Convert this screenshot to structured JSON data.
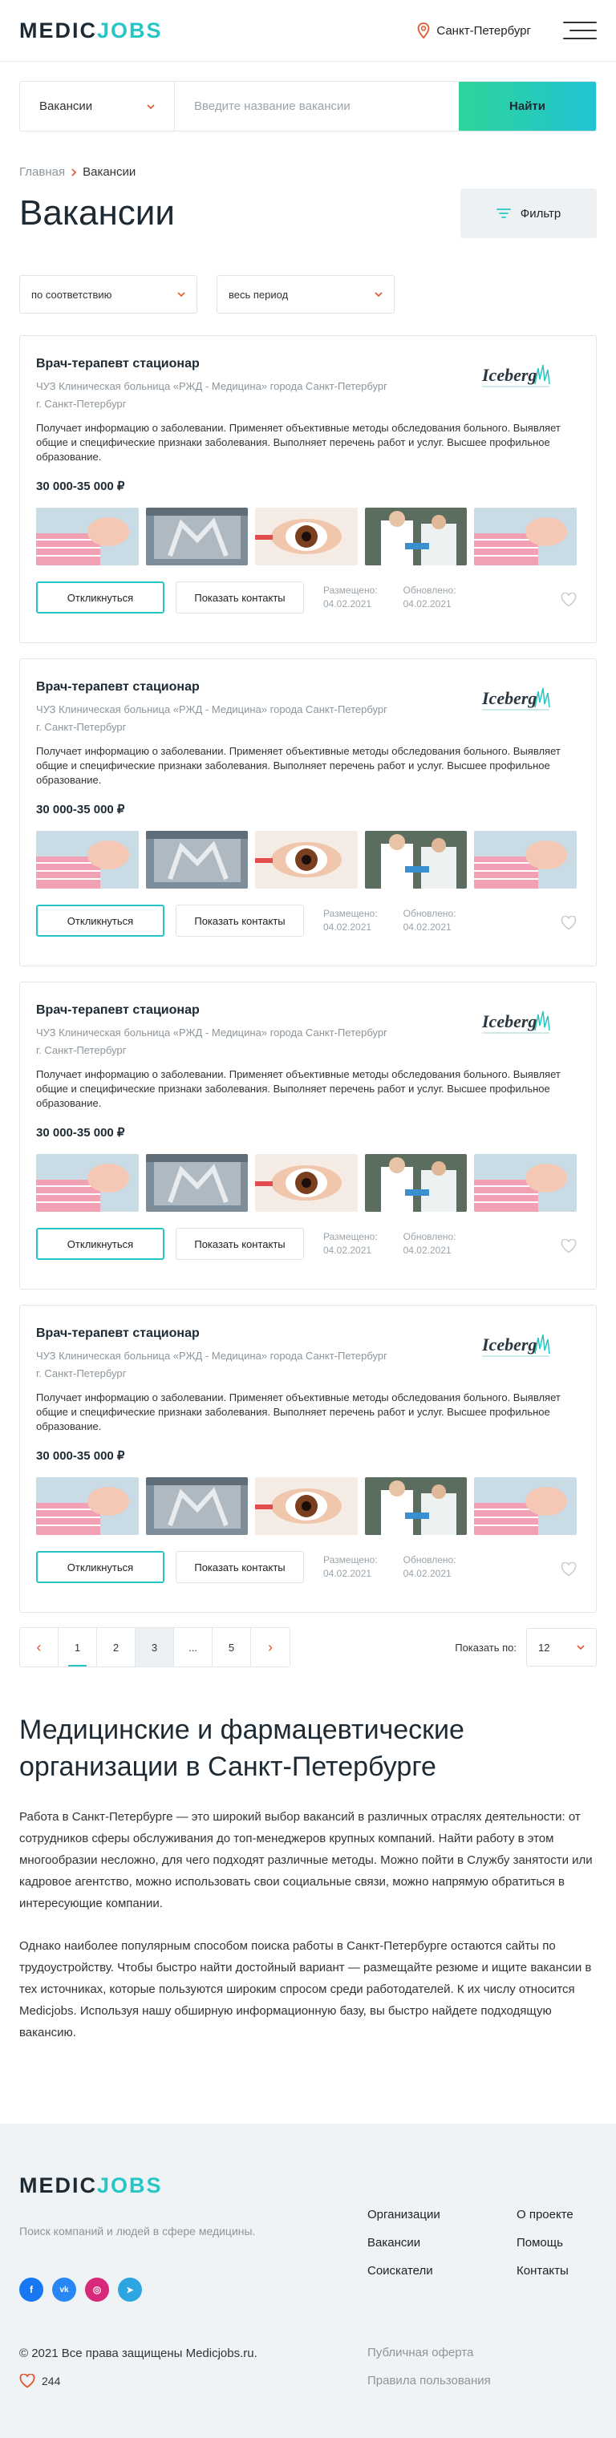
{
  "header": {
    "logo_part1": "MEDIC",
    "logo_part2": "JOBS",
    "city": "Санкт-Петербург"
  },
  "search": {
    "category": "Вакансии",
    "placeholder": "Введите название вакансии",
    "button": "Найти"
  },
  "breadcrumb": {
    "home": "Главная",
    "current": "Вакансии"
  },
  "page": {
    "title": "Вакансии",
    "filter": "Фильтр"
  },
  "sort": {
    "relevance": "по соответствию",
    "period": "весь период"
  },
  "vacancies": [
    {
      "title": "Врач-терапевт стационар",
      "org": "ЧУЗ Клиническая больница «РЖД - Медицина» города Санкт-Петербург",
      "city": "г. Санкт-Петербург",
      "desc": "Получает информацию о заболевании. Применяет объективные методы обследования больного. Выявляет общие и специфические признаки заболевания. Выполняет перечень работ и услуг. Высшее профильное образование.",
      "salary": "30 000-35 000 ₽",
      "employer_logo": "Iceberg",
      "respond": "Откликнуться",
      "contacts": "Показать контакты",
      "posted_label": "Размещено:",
      "posted": "04.02.2021",
      "updated_label": "Обновлено:",
      "updated": "04.02.2021"
    },
    {
      "title": "Врач-терапевт стационар",
      "org": "ЧУЗ Клиническая больница «РЖД - Медицина» города Санкт-Петербург",
      "city": "г. Санкт-Петербург",
      "desc": "Получает информацию о заболевании. Применяет объективные методы обследования больного. Выявляет общие и специфические признаки заболевания. Выполняет перечень работ и услуг. Высшее профильное образование.",
      "salary": "30 000-35 000 ₽",
      "employer_logo": "Iceberg",
      "respond": "Откликнуться",
      "contacts": "Показать контакты",
      "posted_label": "Размещено:",
      "posted": "04.02.2021",
      "updated_label": "Обновлено:",
      "updated": "04.02.2021"
    },
    {
      "title": "Врач-терапевт стационар",
      "org": "ЧУЗ Клиническая больница «РЖД - Медицина» города Санкт-Петербург",
      "city": "г. Санкт-Петербург",
      "desc": "Получает информацию о заболевании. Применяет объективные методы обследования больного. Выявляет общие и специфические признаки заболевания. Выполняет перечень работ и услуг. Высшее профильное образование.",
      "salary": "30 000-35 000 ₽",
      "employer_logo": "Iceberg",
      "respond": "Откликнуться",
      "contacts": "Показать контакты",
      "posted_label": "Размещено:",
      "posted": "04.02.2021",
      "updated_label": "Обновлено:",
      "updated": "04.02.2021"
    },
    {
      "title": "Врач-терапевт стационар",
      "org": "ЧУЗ Клиническая больница «РЖД - Медицина» города Санкт-Петербург",
      "city": "г. Санкт-Петербург",
      "desc": "Получает информацию о заболевании. Применяет объективные методы обследования больного. Выявляет общие и специфические признаки заболевания. Выполняет перечень работ и услуг. Высшее профильное образование.",
      "salary": "30 000-35 000 ₽",
      "employer_logo": "Iceberg",
      "respond": "Откликнуться",
      "contacts": "Показать контакты",
      "posted_label": "Размещено:",
      "posted": "04.02.2021",
      "updated_label": "Обновлено:",
      "updated": "04.02.2021"
    }
  ],
  "pagination": {
    "pages": [
      "1",
      "2",
      "3",
      "...",
      "5"
    ],
    "active": "1",
    "current": "3",
    "per_page_label": "Показать по:",
    "per_page": "12"
  },
  "seo": {
    "title": "Медицинские и фармацевтические организации в Санкт-Петербурге",
    "p1": "Работа в Санкт-Петербурге — это широкий выбор вакансий в различных отраслях деятельности: от сотрудников сферы обслуживания до топ-менеджеров крупных компаний. Найти работу в этом многообразии несложно, для чего подходят различные методы. Можно пойти в Службу занятости или кадровое агентство, можно использовать свои социальные связи, можно напрямую обратиться в интересующие компании.",
    "p2": "Однако наиболее популярным способом поиска работы в Санкт-Петербурге остаются сайты по трудоустройству. Чтобы быстро найти достойный вариант — размещайте резюме и ищите вакансии в тех источниках, которые пользуются широким спросом среди работодателей. К их числу относится Medicjobs. Используя нашу обширную информационную базу, вы быстро найдете подходящую вакансию."
  },
  "footer": {
    "logo_part1": "MEDIC",
    "logo_part2": "JOBS",
    "tagline": "Поиск компаний и людей в сфере медицины.",
    "col1": [
      "Организации",
      "Вакансии",
      "Соискатели"
    ],
    "col2": [
      "О проекте",
      "Помощь",
      "Контакты"
    ],
    "copyright": "© 2021 Все права защищены Medicjobs.ru.",
    "likes": "244",
    "legal": [
      "Публичная оферта",
      "Правила пользования"
    ],
    "socials": [
      {
        "name": "facebook-icon",
        "glyph": "f",
        "color": "#1877f2"
      },
      {
        "name": "vk-icon",
        "glyph": "vk",
        "color": "#2787f5"
      },
      {
        "name": "instagram-icon",
        "glyph": "◎",
        "color": "#d8287a"
      },
      {
        "name": "telegram-icon",
        "glyph": "➤",
        "color": "#2ca5e0"
      }
    ]
  },
  "colors": {
    "accent": "#27c6c6",
    "arrow": "#e3552e",
    "gradient_start": "#2ed49a",
    "gradient_end": "#21c3d3"
  }
}
